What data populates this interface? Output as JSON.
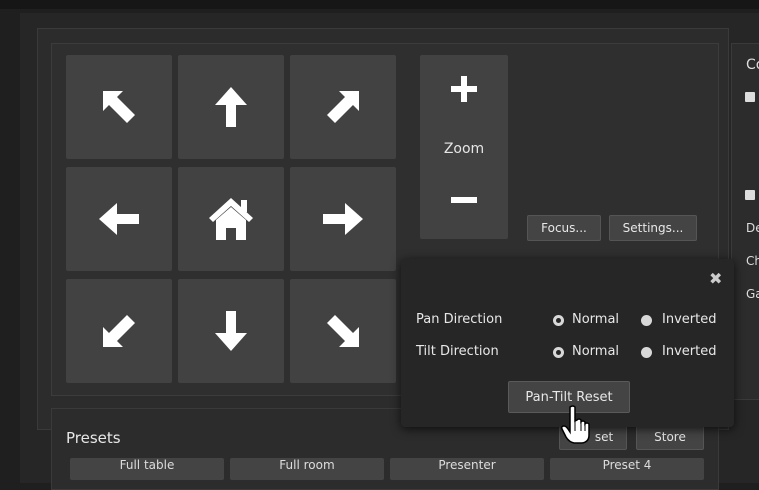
{
  "ptz": {
    "buttons": [
      {
        "name": "pan-up-left-button",
        "icon": "arrow-up-left-icon"
      },
      {
        "name": "tilt-up-button",
        "icon": "arrow-up-icon"
      },
      {
        "name": "pan-up-right-button",
        "icon": "arrow-up-right-icon"
      },
      {
        "name": "pan-left-button",
        "icon": "arrow-left-icon"
      },
      {
        "name": "home-button",
        "icon": "home-icon"
      },
      {
        "name": "pan-right-button",
        "icon": "arrow-right-icon"
      },
      {
        "name": "pan-down-left-button",
        "icon": "arrow-down-left-icon"
      },
      {
        "name": "tilt-down-button",
        "icon": "arrow-down-icon"
      },
      {
        "name": "pan-down-right-button",
        "icon": "arrow-down-right-icon"
      }
    ],
    "zoom_label": "Zoom",
    "zoom_in_icon": "plus-icon",
    "zoom_out_icon": "minus-icon",
    "focus_label": "Focus...",
    "settings_label": "Settings..."
  },
  "side": {
    "items": [
      "Co",
      "De",
      "Ch",
      "Ga"
    ]
  },
  "presets": {
    "title": "Presets",
    "reset_label": "Reset",
    "reset_visible": "set",
    "store_label": "Store",
    "items": [
      "Full table",
      "Full room",
      "Presenter",
      "Preset 4"
    ]
  },
  "popup": {
    "close_icon": "close-icon",
    "pan_label": "Pan Direction",
    "tilt_label": "Tilt Direction",
    "normal_label": "Normal",
    "inverted_label": "Inverted",
    "pan_value": "Normal",
    "tilt_value": "Normal",
    "reset_button": "Pan-Tilt Reset"
  },
  "colors": {
    "background": "#1f1f1f",
    "panel": "#2c2c2c",
    "button": "#424242",
    "text": "#e8e8e8"
  }
}
